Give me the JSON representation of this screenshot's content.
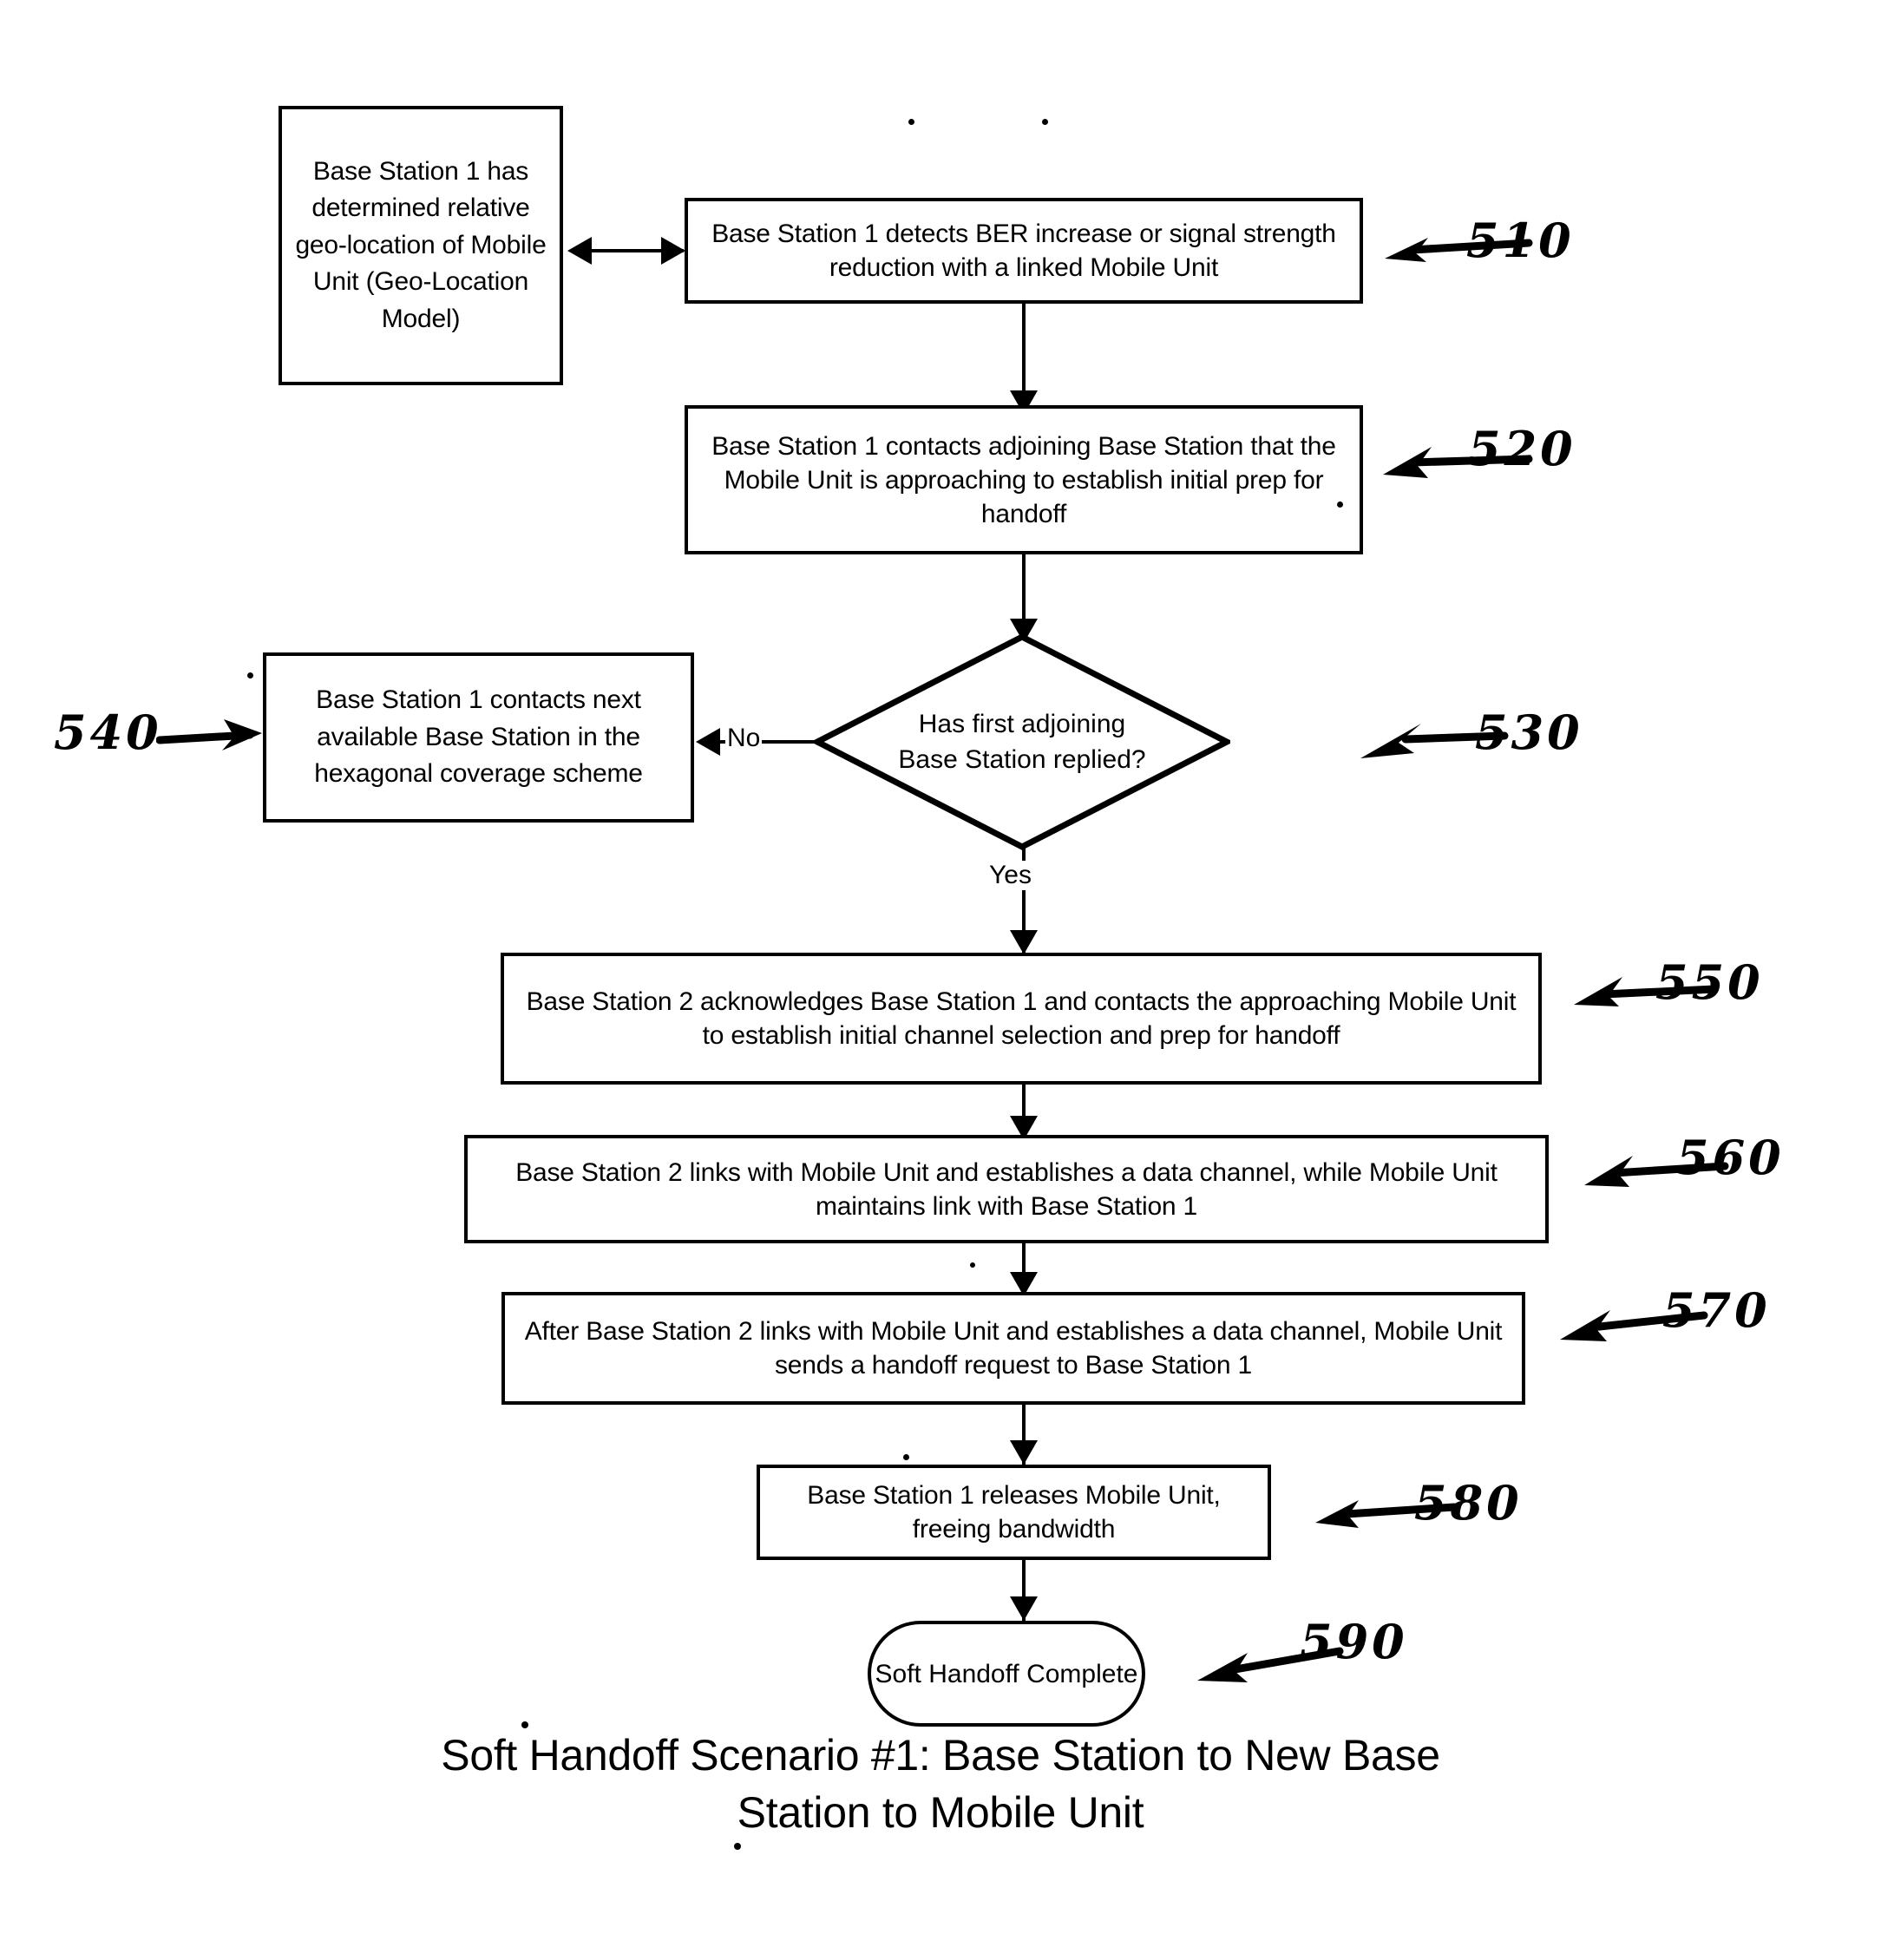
{
  "figure": {
    "caption_line1": "Soft Handoff Scenario #1: Base Station to New Base",
    "caption_line2": "Station to Mobile Unit"
  },
  "nodes": {
    "geo_model": {
      "id": "geo-location-model",
      "text": "Base Station 1 has determined relative geo-location of Mobile Unit (Geo-Location Model)",
      "shape": "process"
    },
    "n510": {
      "ref": "510",
      "text": "Base Station 1 detects BER increase or signal strength reduction with a linked Mobile Unit",
      "shape": "process"
    },
    "n520": {
      "ref": "520",
      "text": "Base Station 1 contacts adjoining Base Station that the Mobile Unit is approaching to establish initial prep for handoff",
      "shape": "process"
    },
    "n530": {
      "ref": "530",
      "text": "Has first adjoining Base Station replied?",
      "shape": "decision",
      "line1": "Has first adjoining",
      "line2": "Base Station replied?"
    },
    "n540": {
      "ref": "540",
      "text": "Base Station 1 contacts next available Base Station in the hexagonal coverage scheme",
      "shape": "process"
    },
    "n550": {
      "ref": "550",
      "text": "Base Station 2 acknowledges Base Station 1 and contacts the approaching Mobile Unit to establish initial channel selection and prep for handoff",
      "shape": "process"
    },
    "n560": {
      "ref": "560",
      "text": "Base Station 2 links with Mobile Unit and establishes a data channel, while Mobile Unit maintains link with Base Station 1",
      "shape": "process"
    },
    "n570": {
      "ref": "570",
      "text": "After Base Station 2 links with Mobile Unit and establishes a data channel, Mobile Unit sends a handoff request to Base Station 1",
      "shape": "process"
    },
    "n580": {
      "ref": "580",
      "text": "Base Station 1 releases Mobile Unit, freeing bandwidth",
      "shape": "process"
    },
    "n590": {
      "ref": "590",
      "text": "Soft Handoff Complete",
      "shape": "terminator"
    }
  },
  "edge_labels": {
    "no": "No",
    "yes": "Yes"
  },
  "annotations": {
    "a510": "510",
    "a520": "520",
    "a530": "530",
    "a540": "540",
    "a550": "550",
    "a560": "560",
    "a570": "570",
    "a580": "580",
    "a590": "590"
  },
  "colors": {
    "ink": "#000000",
    "paper": "#ffffff"
  }
}
